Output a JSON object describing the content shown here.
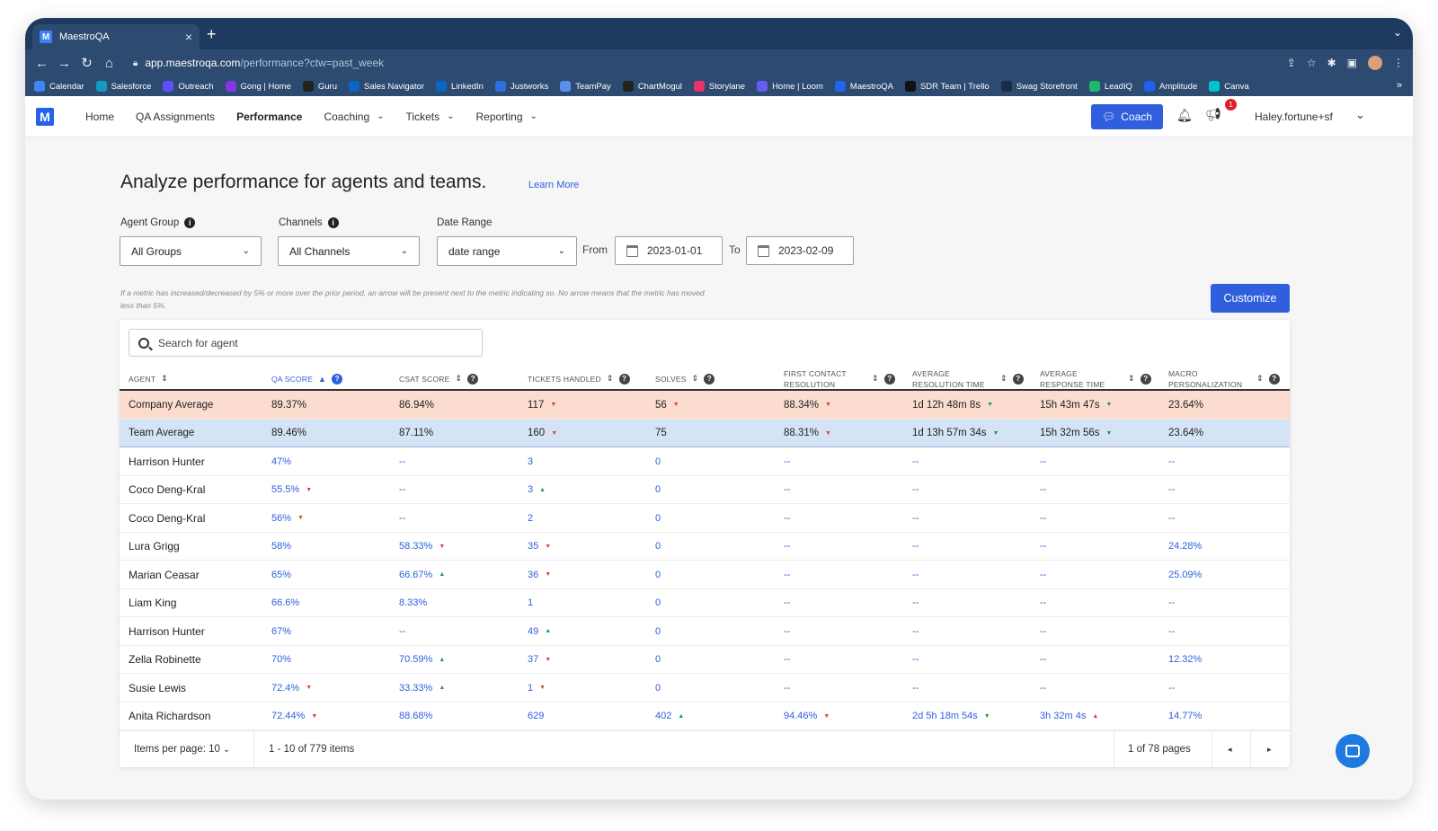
{
  "browser": {
    "tab_title": "MaestroQA",
    "url_host": "app.maestroqa.com",
    "url_path": "/performance?ctw=past_week",
    "bookmarks": [
      {
        "label": "Calendar",
        "color": "#4285f4"
      },
      {
        "label": "Salesforce",
        "color": "#1798c1"
      },
      {
        "label": "Outreach",
        "color": "#5951ff"
      },
      {
        "label": "Gong | Home",
        "color": "#8039df"
      },
      {
        "label": "Guru",
        "color": "#222222"
      },
      {
        "label": "Sales Navigator",
        "color": "#0a66c2"
      },
      {
        "label": "LinkedIn",
        "color": "#0a66c2"
      },
      {
        "label": "Justworks",
        "color": "#2f6fe0"
      },
      {
        "label": "TeamPay",
        "color": "#5b8def"
      },
      {
        "label": "ChartMogul",
        "color": "#222222"
      },
      {
        "label": "Storylane",
        "color": "#e8336d"
      },
      {
        "label": "Home | Loom",
        "color": "#625df5"
      },
      {
        "label": "MaestroQA",
        "color": "#2563eb"
      },
      {
        "label": "SDR Team | Trello",
        "color": "#111111"
      },
      {
        "label": "Swag Storefront",
        "color": "#1b2b44"
      },
      {
        "label": "LeadIQ",
        "color": "#1fb86b"
      },
      {
        "label": "Amplitude",
        "color": "#1e61f0"
      },
      {
        "label": "Canva",
        "color": "#00c4cc"
      }
    ]
  },
  "nav": {
    "logo": "M",
    "items": [
      {
        "label": "Home",
        "dropdown": false,
        "active": false
      },
      {
        "label": "QA Assignments",
        "dropdown": false,
        "active": false
      },
      {
        "label": "Performance",
        "dropdown": false,
        "active": true
      },
      {
        "label": "Coaching",
        "dropdown": true,
        "active": false
      },
      {
        "label": "Tickets",
        "dropdown": true,
        "active": false
      },
      {
        "label": "Reporting",
        "dropdown": true,
        "active": false
      }
    ],
    "coach_button": "Coach",
    "notification_count": "1",
    "user": "Haley.fortune+sf"
  },
  "page": {
    "heading": "Analyze performance for agents and teams.",
    "learn_more": "Learn More",
    "filters": {
      "agent_group_label": "Agent Group",
      "agent_group_value": "All Groups",
      "channels_label": "Channels",
      "channels_value": "All Channels",
      "date_range_label": "Date Range",
      "date_range_value": "date range",
      "from_label": "From",
      "from_value": "2023-01-01",
      "to_label": "To",
      "to_value": "2023-02-09"
    },
    "note": "If a metric has increased/decreased by 5% or more over the prior period, an arrow will be present next to the metric indicating so. No arrow means that the metric has moved less than 5%.",
    "customize": "Customize",
    "search_placeholder": "Search for agent"
  },
  "table": {
    "columns": [
      "Agent",
      "QA Score",
      "CSAT Score",
      "Tickets Handled",
      "Solves",
      "First Contact Resolution",
      "Average Resolution Time",
      "Average Response Time",
      "Macro Personalization"
    ],
    "sorted_column": "QA Score",
    "summary_rows": [
      {
        "type": "company",
        "cells": [
          {
            "v": "Company Average"
          },
          {
            "v": "89.37%"
          },
          {
            "v": "86.94%"
          },
          {
            "v": "117",
            "a": "down"
          },
          {
            "v": "56",
            "a": "down"
          },
          {
            "v": "88.34%",
            "a": "down"
          },
          {
            "v": "1d 12h 48m 8s",
            "a": "down-green"
          },
          {
            "v": "15h 43m 47s",
            "a": "down-green"
          },
          {
            "v": "23.64%"
          }
        ]
      },
      {
        "type": "team",
        "cells": [
          {
            "v": "Team Average"
          },
          {
            "v": "89.46%"
          },
          {
            "v": "87.11%"
          },
          {
            "v": "160",
            "a": "down"
          },
          {
            "v": "75"
          },
          {
            "v": "88.31%",
            "a": "down"
          },
          {
            "v": "1d 13h 57m 34s",
            "a": "down-green"
          },
          {
            "v": "15h 32m 56s",
            "a": "down-green"
          },
          {
            "v": "23.64%"
          }
        ]
      }
    ],
    "rows": [
      {
        "cells": [
          {
            "v": "Harrison Hunter"
          },
          {
            "v": "47%"
          },
          {
            "v": "--"
          },
          {
            "v": "3"
          },
          {
            "v": "0"
          },
          {
            "v": "--"
          },
          {
            "v": "--"
          },
          {
            "v": "--"
          },
          {
            "v": "--"
          }
        ]
      },
      {
        "cells": [
          {
            "v": "Coco Deng-Kral"
          },
          {
            "v": "55.5%",
            "a": "down"
          },
          {
            "v": "--"
          },
          {
            "v": "3",
            "a": "up"
          },
          {
            "v": "0"
          },
          {
            "v": "--"
          },
          {
            "v": "--"
          },
          {
            "v": "--"
          },
          {
            "v": "--"
          }
        ]
      },
      {
        "cells": [
          {
            "v": "Coco Deng-Kral"
          },
          {
            "v": "56%",
            "a": "down"
          },
          {
            "v": "--"
          },
          {
            "v": "2"
          },
          {
            "v": "0"
          },
          {
            "v": "--"
          },
          {
            "v": "--"
          },
          {
            "v": "--"
          },
          {
            "v": "--"
          }
        ]
      },
      {
        "cells": [
          {
            "v": "Lura Grigg"
          },
          {
            "v": "58%"
          },
          {
            "v": "58.33%",
            "a": "down"
          },
          {
            "v": "35",
            "a": "down"
          },
          {
            "v": "0"
          },
          {
            "v": "--"
          },
          {
            "v": "--"
          },
          {
            "v": "--"
          },
          {
            "v": "24.28%"
          }
        ]
      },
      {
        "cells": [
          {
            "v": "Marian Ceasar"
          },
          {
            "v": "65%"
          },
          {
            "v": "66.67%",
            "a": "up"
          },
          {
            "v": "36",
            "a": "down"
          },
          {
            "v": "0"
          },
          {
            "v": "--"
          },
          {
            "v": "--"
          },
          {
            "v": "--"
          },
          {
            "v": "25.09%"
          }
        ]
      },
      {
        "cells": [
          {
            "v": "Liam King"
          },
          {
            "v": "66.6%"
          },
          {
            "v": "8.33%"
          },
          {
            "v": "1"
          },
          {
            "v": "0"
          },
          {
            "v": "--"
          },
          {
            "v": "--"
          },
          {
            "v": "--"
          },
          {
            "v": "--"
          }
        ]
      },
      {
        "cells": [
          {
            "v": "Harrison Hunter"
          },
          {
            "v": "67%"
          },
          {
            "v": "--"
          },
          {
            "v": "49",
            "a": "up"
          },
          {
            "v": "0"
          },
          {
            "v": "--"
          },
          {
            "v": "--"
          },
          {
            "v": "--"
          },
          {
            "v": "--"
          }
        ]
      },
      {
        "cells": [
          {
            "v": "Zella Robinette"
          },
          {
            "v": "70%"
          },
          {
            "v": "70.59%",
            "a": "up"
          },
          {
            "v": "37",
            "a": "down"
          },
          {
            "v": "0"
          },
          {
            "v": "--"
          },
          {
            "v": "--"
          },
          {
            "v": "--"
          },
          {
            "v": "12.32%"
          }
        ]
      },
      {
        "cells": [
          {
            "v": "Susie Lewis"
          },
          {
            "v": "72.4%",
            "a": "down"
          },
          {
            "v": "33.33%",
            "a": "up"
          },
          {
            "v": "1",
            "a": "down"
          },
          {
            "v": "0"
          },
          {
            "v": "--"
          },
          {
            "v": "--"
          },
          {
            "v": "--"
          },
          {
            "v": "--"
          }
        ]
      },
      {
        "cells": [
          {
            "v": "Anita Richardson"
          },
          {
            "v": "72.44%",
            "a": "down"
          },
          {
            "v": "88.68%"
          },
          {
            "v": "629"
          },
          {
            "v": "402",
            "a": "up"
          },
          {
            "v": "94.46%",
            "a": "down"
          },
          {
            "v": "2d 5h 18m 54s",
            "a": "down-green"
          },
          {
            "v": "3h 32m 4s",
            "a": "up-red"
          },
          {
            "v": "14.77%"
          }
        ]
      }
    ]
  },
  "pagination": {
    "items_per_page": "Items per page: 10",
    "range": "1 - 10 of 779 items",
    "pages": "1 of 78 pages"
  },
  "colors": {
    "accent": "#2f5fdc",
    "company_row": "#fbdccf",
    "team_row": "#d5e3f6",
    "arrow_down": "#d14a2b",
    "arrow_up": "#1a9a5a"
  }
}
